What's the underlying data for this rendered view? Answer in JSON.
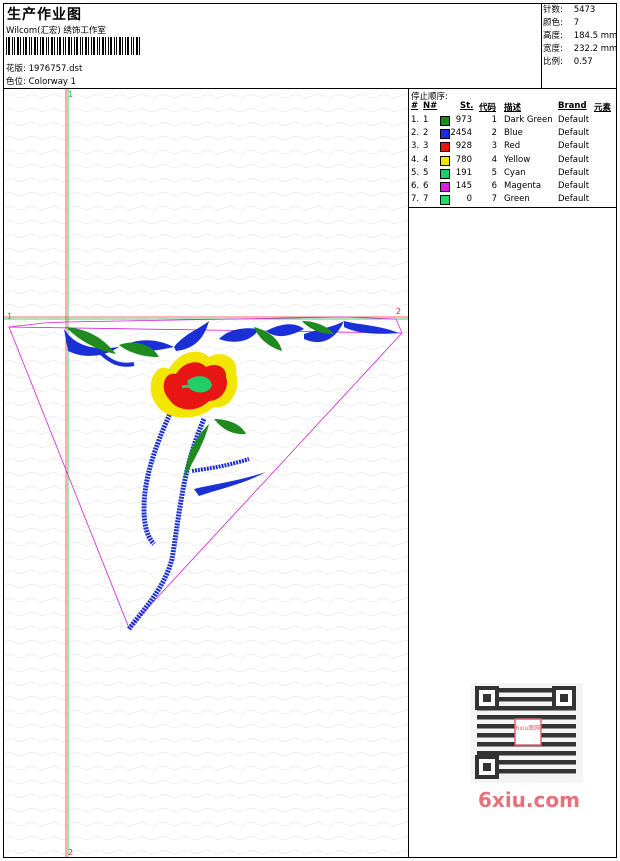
{
  "header": {
    "title": "生产作业图",
    "company": "Wilcom(汇宏) 绣饰工作室",
    "design_label": "花版:",
    "design_value": "1976757.dst",
    "colorway_label": "色位:",
    "colorway_value": "Colorway 1"
  },
  "stats": {
    "stitches_label": "针数:",
    "stitches": "5473",
    "colors_label": "颜色:",
    "colors": "7",
    "height_label": "高度:",
    "height": "184.5 mm",
    "width_label": "宽度:",
    "width": "232.2 mm",
    "scale_label": "比例:",
    "scale": "0.57"
  },
  "stop_sequence": {
    "title": "停止顺序:",
    "columns": [
      "#",
      "N#",
      "St.",
      "代码",
      "描述",
      "Brand",
      "元素"
    ],
    "rows": [
      {
        "num": "1.",
        "n": "1",
        "color": "#1f8a1f",
        "st": "973",
        "code": "1",
        "desc": "Dark Green",
        "brand": "Default"
      },
      {
        "num": "2.",
        "n": "2",
        "color": "#1a2fd6",
        "st": "2454",
        "code": "2",
        "desc": "Blue",
        "brand": "Default"
      },
      {
        "num": "3.",
        "n": "3",
        "color": "#e81515",
        "st": "928",
        "code": "3",
        "desc": "Red",
        "brand": "Default"
      },
      {
        "num": "4.",
        "n": "4",
        "color": "#f2e600",
        "st": "780",
        "code": "4",
        "desc": "Yellow",
        "brand": "Default"
      },
      {
        "num": "5.",
        "n": "5",
        "color": "#22cc66",
        "st": "191",
        "code": "5",
        "desc": "Cyan",
        "brand": "Default"
      },
      {
        "num": "6.",
        "n": "6",
        "color": "#e01ee0",
        "st": "145",
        "code": "6",
        "desc": "Magenta",
        "brand": "Default"
      },
      {
        "num": "7.",
        "n": "7",
        "color": "#22dd66",
        "st": "0",
        "code": "7",
        "desc": "Green",
        "brand": "Default"
      }
    ]
  },
  "markers": {
    "v_top": "1",
    "v_bottom": "2",
    "h_left": "1",
    "h_right": "2"
  },
  "watermark": {
    "text": "6xiu.com",
    "stamp": "6xiu图网"
  }
}
